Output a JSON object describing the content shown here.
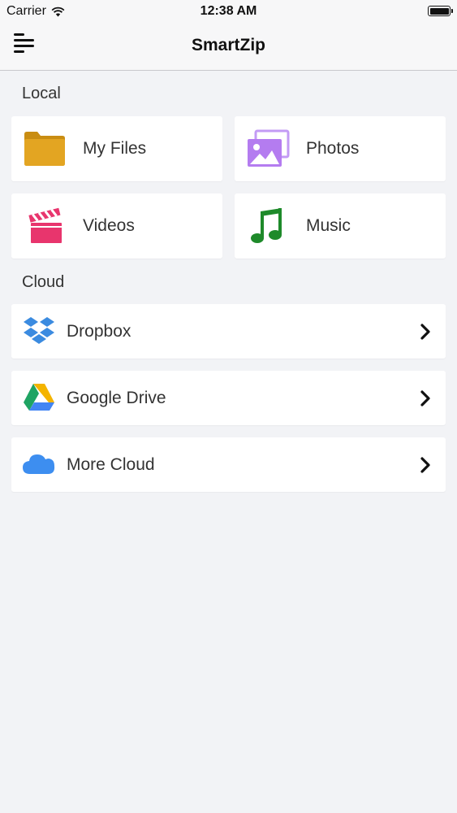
{
  "status_bar": {
    "carrier": "Carrier",
    "time": "12:38 AM",
    "icons": [
      "wifi-icon",
      "battery-icon"
    ]
  },
  "nav": {
    "title": "SmartZip",
    "menu_icon": "menu-icon"
  },
  "local": {
    "label": "Local",
    "items": [
      {
        "label": "My Files",
        "icon": "folder-icon",
        "color": "#e0a21a"
      },
      {
        "label": "Photos",
        "icon": "photos-icon",
        "color": "#b47cf0"
      },
      {
        "label": "Videos",
        "icon": "clapperboard-icon",
        "color": "#e8356d"
      },
      {
        "label": "Music",
        "icon": "music-note-icon",
        "color": "#1e8a2a"
      }
    ]
  },
  "cloud": {
    "label": "Cloud",
    "items": [
      {
        "label": "Dropbox",
        "icon": "dropbox-icon",
        "color": "#3b8be0"
      },
      {
        "label": "Google Drive",
        "icon": "google-drive-icon",
        "color": "#f4b400"
      },
      {
        "label": "More Cloud",
        "icon": "cloud-icon",
        "color": "#3d8ef0"
      }
    ]
  },
  "colors": {
    "background": "#f2f3f6",
    "card": "#ffffff",
    "text": "#333333"
  }
}
